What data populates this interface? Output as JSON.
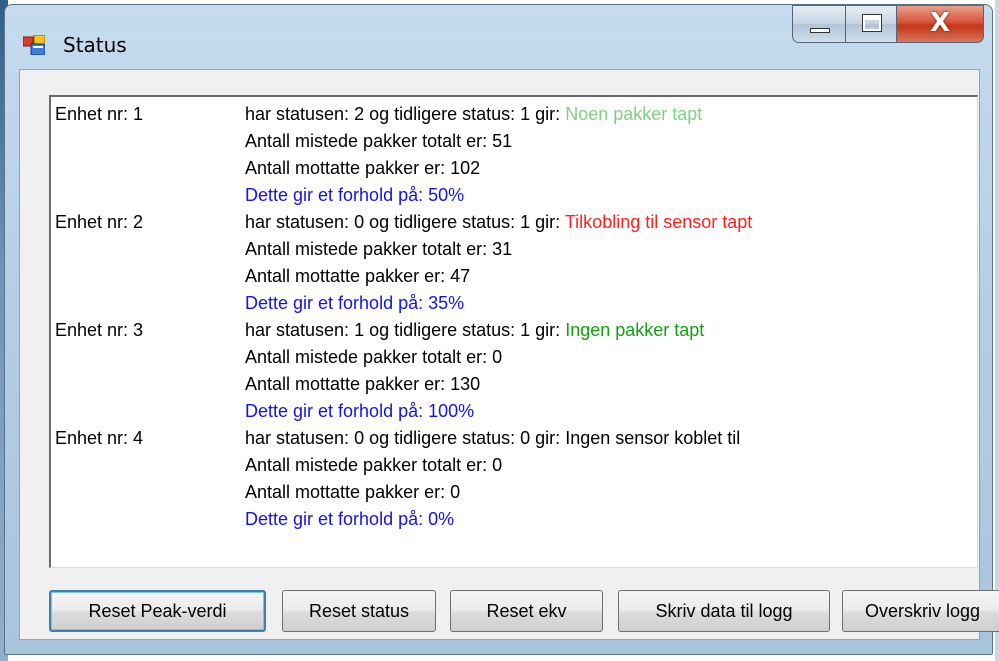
{
  "window": {
    "title": "Status",
    "close_glyph": "X",
    "icon": "app-window-icon"
  },
  "colors": {
    "green_light": "#7ed37e",
    "red": "#ff2020",
    "green": "#10a010",
    "blue": "#1414e8",
    "black": "#000000"
  },
  "units": [
    {
      "label": "Enhet nr: 1",
      "status_prefix": "har statusen: 2 og tidligere status: 1 gir: ",
      "status_text": "Noen pakker tapt",
      "status_color": "#7ed37e",
      "lost": "Antall mistede pakker totalt er: 51",
      "received": "Antall mottatte pakker er: 102",
      "ratio": "Dette gir et forhold på: 50%"
    },
    {
      "label": "Enhet nr: 2",
      "status_prefix": "har statusen: 0 og tidligere status: 1 gir: ",
      "status_text": "Tilkobling til sensor tapt",
      "status_color": "#ff2020",
      "lost": "Antall mistede pakker totalt er: 31",
      "received": "Antall mottatte pakker er: 47",
      "ratio": "Dette gir et forhold på: 35%"
    },
    {
      "label": "Enhet nr: 3",
      "status_prefix": "har statusen: 1 og tidligere status: 1 gir: ",
      "status_text": "Ingen pakker tapt",
      "status_color": "#10a010",
      "lost": "Antall mistede pakker totalt er: 0",
      "received": "Antall mottatte pakker er: 130",
      "ratio": "Dette gir et forhold på: 100%"
    },
    {
      "label": "Enhet nr: 4",
      "status_prefix": "har statusen: 0 og tidligere status: 0 gir: ",
      "status_text": "Ingen sensor koblet til",
      "status_color": "#000000",
      "lost": "Antall mistede pakker totalt er: 0",
      "received": "Antall mottatte pakker er: 0",
      "ratio": "Dette gir et forhold på: 0%"
    }
  ],
  "buttons": {
    "reset_peak": "Reset Peak-verdi",
    "reset_status": "Reset status",
    "reset_ekv": "Reset ekv",
    "write_log": "Skriv data til logg",
    "overwrite_log": "Overskriv logg"
  }
}
